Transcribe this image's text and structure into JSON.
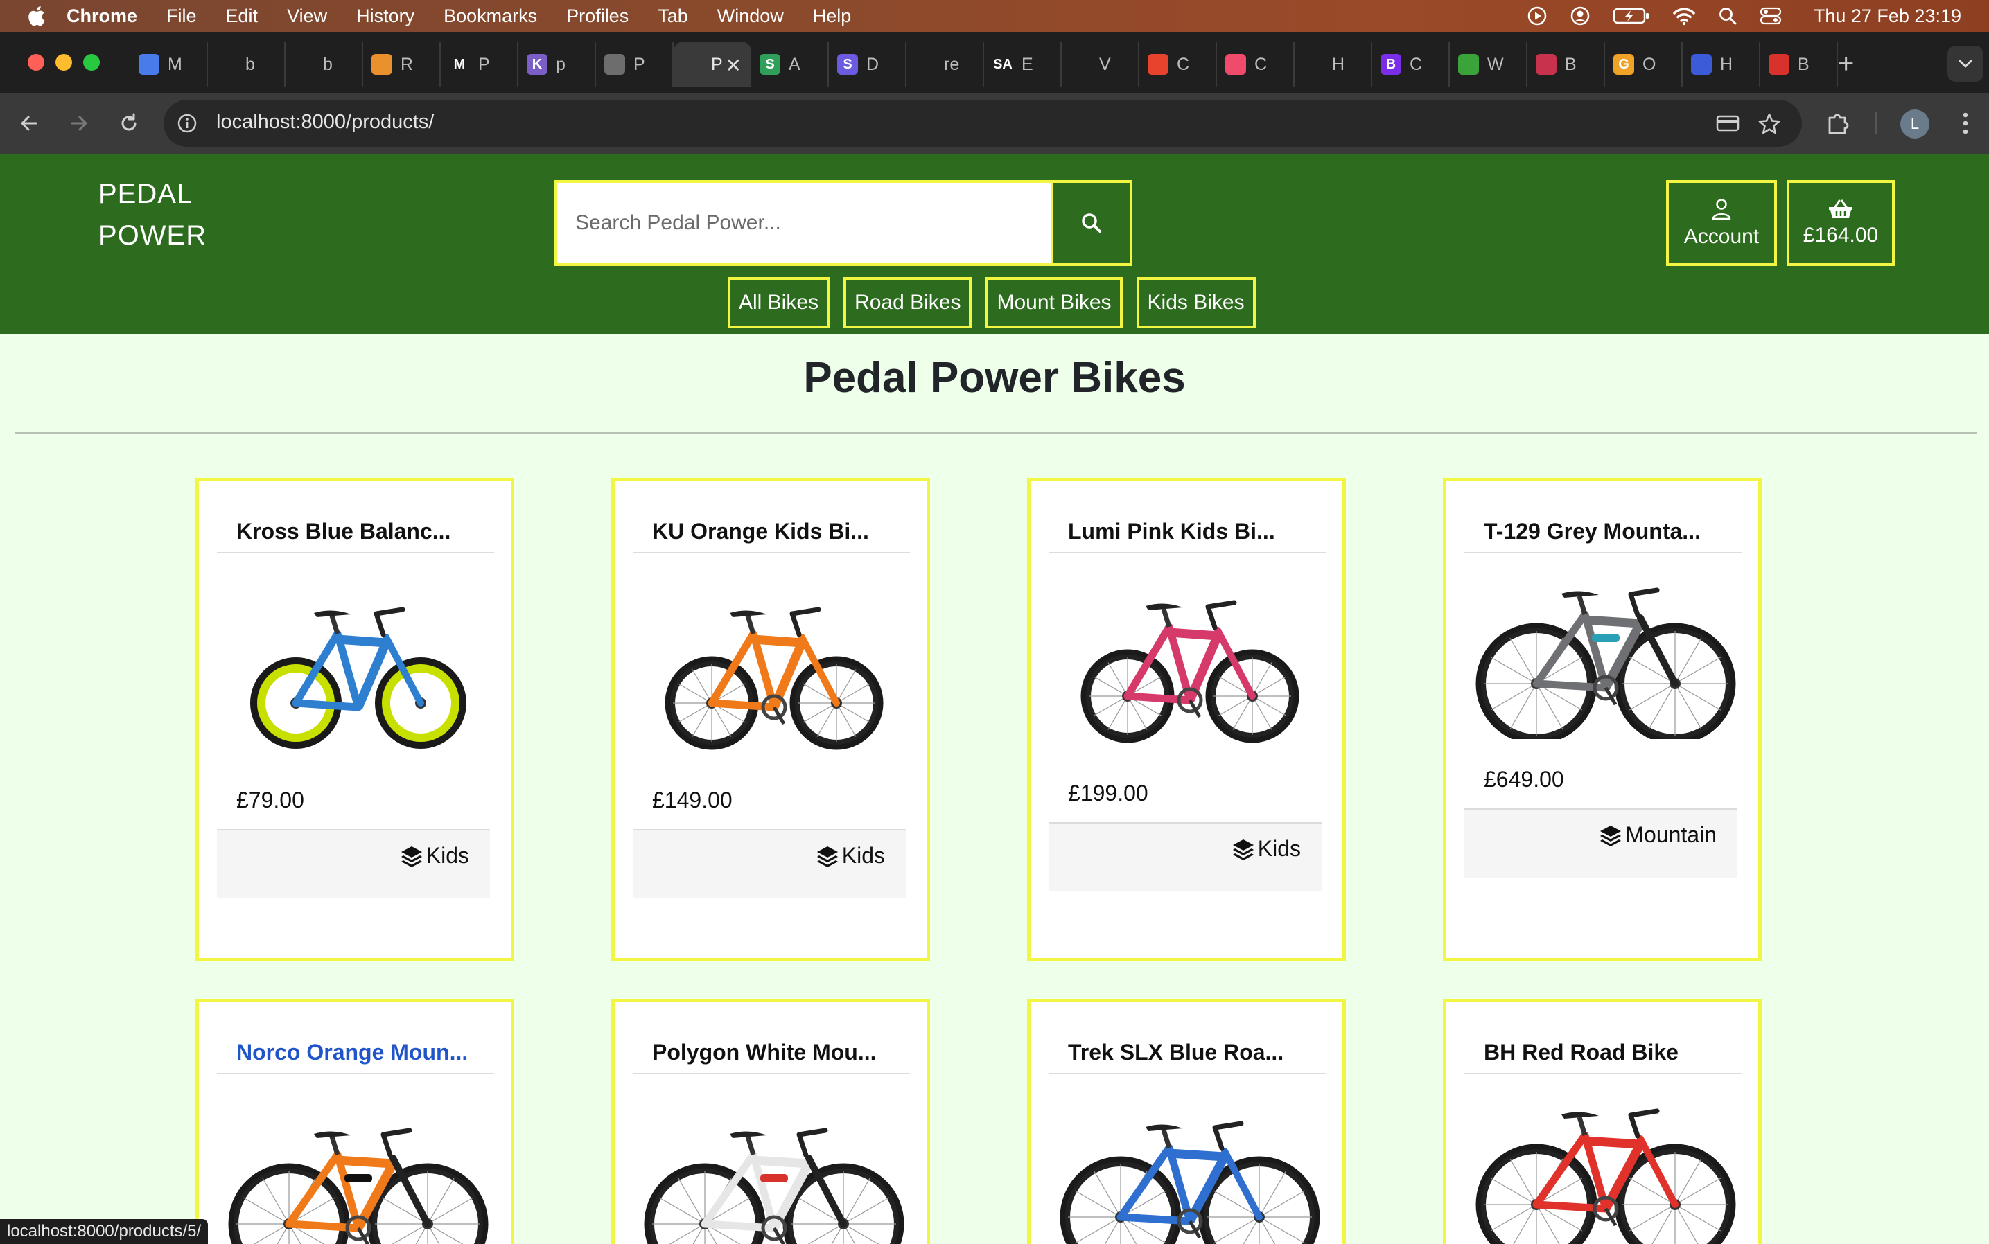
{
  "os_menu": {
    "app": "Chrome",
    "items": [
      "File",
      "Edit",
      "View",
      "History",
      "Bookmarks",
      "Profiles",
      "Tab",
      "Window",
      "Help"
    ],
    "clock": "Thu 27 Feb  23:19"
  },
  "browser": {
    "tabs": [
      {
        "letter": "",
        "title": "M",
        "color": "#4a7bea"
      },
      {
        "letter": "",
        "title": "b",
        "color": "#1f1f1f"
      },
      {
        "letter": "",
        "title": "b",
        "color": "#1f1f1f"
      },
      {
        "letter": "",
        "title": "R",
        "color": "#e8912d"
      },
      {
        "letter": "M",
        "title": "P",
        "color": "#1f1f1f"
      },
      {
        "letter": "K",
        "title": "p",
        "color": "#7b5fc7"
      },
      {
        "letter": "",
        "title": "P",
        "color": "#6d6d6d"
      },
      {
        "letter": "",
        "title": "P",
        "color": "#3a3a3a"
      },
      {
        "letter": "S",
        "title": "A",
        "color": "#2f9f5a"
      },
      {
        "letter": "S",
        "title": "D",
        "color": "#6b5be0"
      },
      {
        "letter": "",
        "title": "re",
        "color": "#1f1f1f"
      },
      {
        "letter": "SA",
        "title": "E",
        "color": "#1f1f1f"
      },
      {
        "letter": "",
        "title": "V",
        "color": "#1f1f1f"
      },
      {
        "letter": "",
        "title": "C",
        "color": "#e8432c"
      },
      {
        "letter": "",
        "title": "C",
        "color": "#f04b6b"
      },
      {
        "letter": "",
        "title": "H",
        "color": "#1f1f1f"
      },
      {
        "letter": "B",
        "title": "C",
        "color": "#7a2ee8"
      },
      {
        "letter": "",
        "title": "W",
        "color": "#3aa33a"
      },
      {
        "letter": "",
        "title": "B",
        "color": "#c8324c"
      },
      {
        "letter": "G",
        "title": "O",
        "color": "#f0a326"
      },
      {
        "letter": "",
        "title": "H",
        "color": "#3b5bd9"
      },
      {
        "letter": "",
        "title": "B",
        "color": "#d8322c"
      }
    ],
    "active_tab_index": 7,
    "url": "localhost:8000/products/",
    "profile_initial": "L",
    "status_url": "localhost:8000/products/5/"
  },
  "site": {
    "logo_line1": "PEDAL",
    "logo_line2": "POWER",
    "search_placeholder": "Search Pedal Power...",
    "account_label": "Account",
    "bag_total": "£164.00",
    "categories": [
      "All Bikes",
      "Road Bikes",
      "Mount Bikes",
      "Kids Bikes"
    ],
    "page_title": "Pedal Power Bikes"
  },
  "products": [
    {
      "name": "Kross Blue Balanc...",
      "price": "£79.00",
      "category": "Kids",
      "frame_color": "#2e7fd0",
      "accent": "#c8e000",
      "kind": "balance",
      "link": false
    },
    {
      "name": "KU Orange Kids Bi...",
      "price": "£149.00",
      "category": "Kids",
      "frame_color": "#f07a1a",
      "accent": "#444444",
      "kind": "kids",
      "link": false
    },
    {
      "name": "Lumi Pink Kids Bi...",
      "price": "£199.00",
      "category": "Kids",
      "frame_color": "#d63a6a",
      "accent": "#333333",
      "kind": "kids",
      "link": false
    },
    {
      "name": "T-129 Grey Mounta...",
      "price": "£649.00",
      "category": "Mountain",
      "frame_color": "#6e7073",
      "accent": "#2aa0b8",
      "kind": "mtb",
      "link": false
    },
    {
      "name": "Norco Orange Moun...",
      "price": "",
      "category": "",
      "frame_color": "#f07a1a",
      "accent": "#111111",
      "kind": "mtb",
      "link": true
    },
    {
      "name": "Polygon White Mou...",
      "price": "",
      "category": "",
      "frame_color": "#e6e6e6",
      "accent": "#d8322c",
      "kind": "mtb",
      "link": false
    },
    {
      "name": "Trek SLX Blue Roa...",
      "price": "",
      "category": "",
      "frame_color": "#2f6fd0",
      "accent": "#ffffff",
      "kind": "road",
      "link": false
    },
    {
      "name": "BH Red Road Bike",
      "price": "",
      "category": "",
      "frame_color": "#e0322a",
      "accent": "#111111",
      "kind": "road",
      "link": false
    }
  ]
}
